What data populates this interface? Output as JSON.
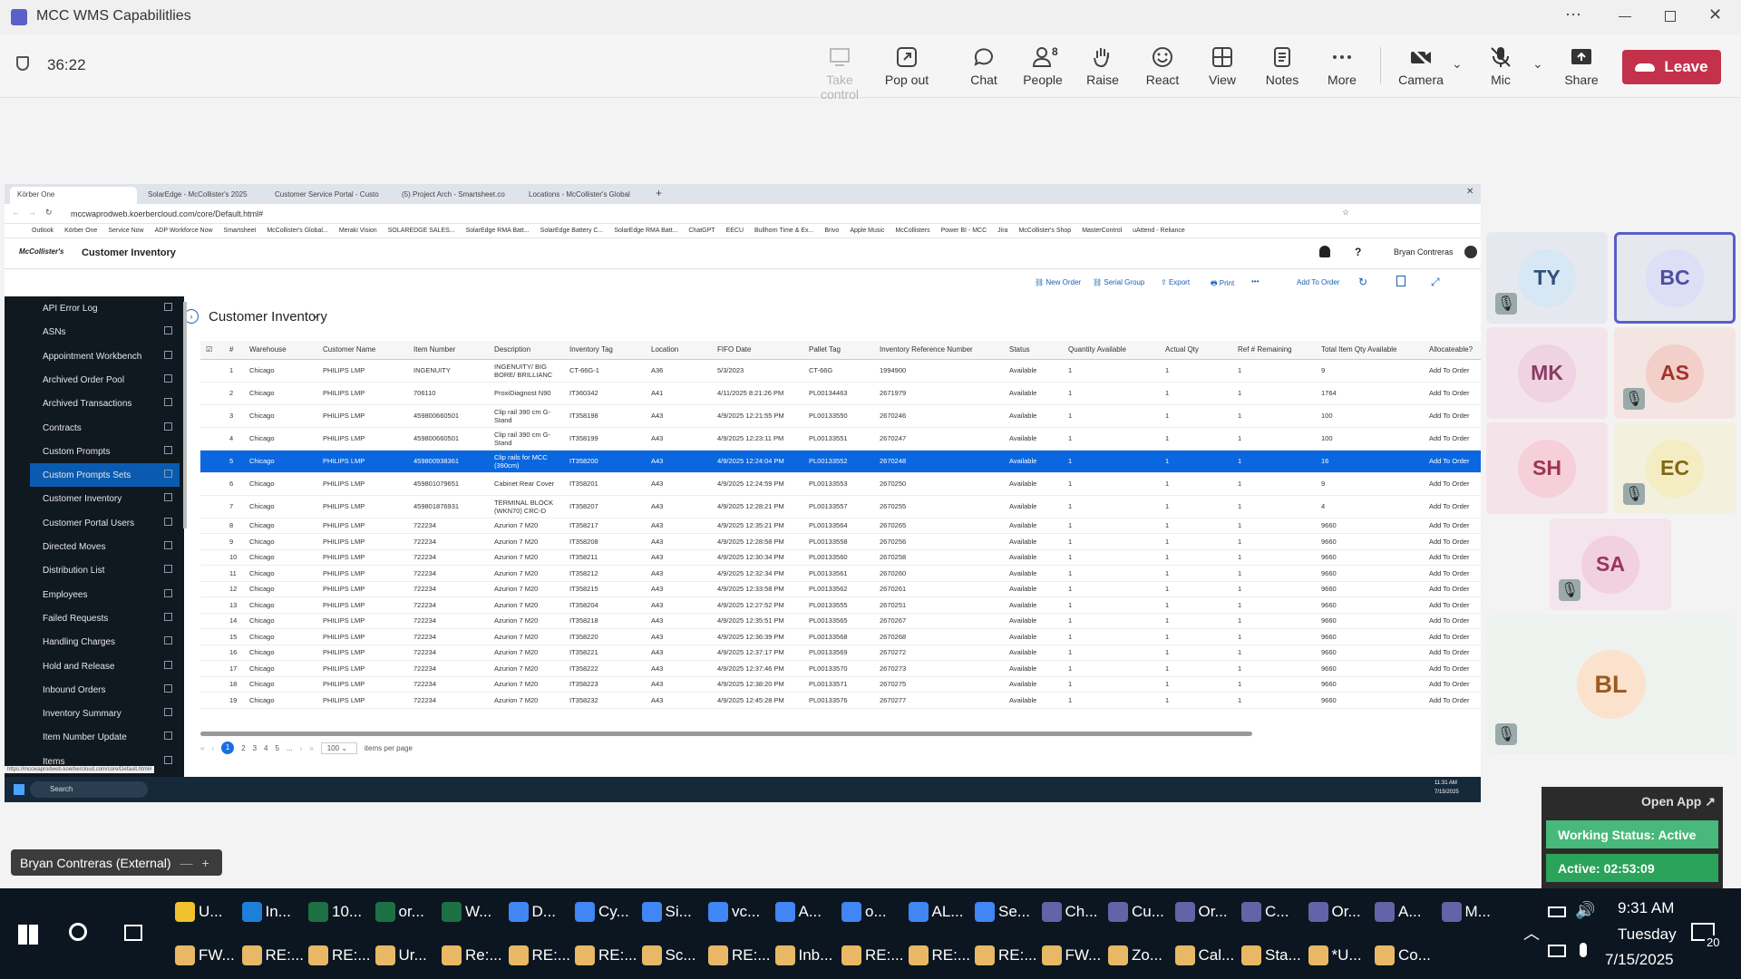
{
  "teams": {
    "window_title": "MCC WMS Capabilitlies",
    "timer": "36:22",
    "buttons": {
      "take_control": "Take control",
      "pop_out": "Pop out",
      "chat": "Chat",
      "people": "People",
      "people_count": "8",
      "raise": "Raise",
      "react": "React",
      "view": "View",
      "notes": "Notes",
      "more": "More",
      "camera": "Camera",
      "mic": "Mic",
      "share": "Share",
      "leave": "Leave"
    },
    "presenter_label": "Bryan Contreras (External)",
    "participants": [
      {
        "initials": "TY",
        "muted": true
      },
      {
        "initials": "BC",
        "muted": false
      },
      {
        "initials": "MK",
        "muted": false
      },
      {
        "initials": "AS",
        "muted": true
      },
      {
        "initials": "SH",
        "muted": false
      },
      {
        "initials": "EC",
        "muted": true
      },
      {
        "initials": "SA",
        "muted": true
      },
      {
        "initials": "BL",
        "muted": true
      }
    ],
    "open_app": "Open App",
    "working_status": "Working Status: Active",
    "active_timer": "Active: 02:53:09"
  },
  "browser": {
    "tabs": [
      "Körber One",
      "SolarEdge - McCollister's 2025",
      "Customer Service Portal - Custo",
      "(5) Project Arch - Smartsheet.co",
      "Locations - McCollister's Global"
    ],
    "url": "mccwaprodweb.koerbercloud.com/core/Default.html#",
    "bookmarks": [
      "Outlook",
      "Körber One",
      "Service Now",
      "ADP Workforce Now",
      "Smartsheet",
      "McCollister's Global...",
      "Meraki Vision",
      "SOLAREDGE SALES...",
      "SolarEdge RMA Batt...",
      "SolarEdge Battery C...",
      "SolarEdge RMA Batt...",
      "ChatGPT",
      "EECU",
      "Bullhorn Time & Ex...",
      "Brivo",
      "Apple Music",
      "McCollisters",
      "Power BI - MCC",
      "Jira",
      "McCollister's Shop",
      "MasterControl",
      "uAttend - Reliance"
    ],
    "status_url": "https://mccwaprodweb.koerbercloud.com/core/Default.html#"
  },
  "app": {
    "logo": "McCollister's",
    "module_title": "Customer Inventory",
    "user": "Bryan Contreras",
    "help": "?",
    "page_title": "Customer Inventory",
    "toolbar": {
      "new_order": "New Order",
      "serial_group": "Serial Group",
      "export": "Export",
      "print": "Print",
      "more": "•••",
      "add_to_order": "Add To Order"
    },
    "nav_items": [
      "API Error Log",
      "ASNs",
      "Appointment Workbench",
      "Archived Order Pool",
      "Archived Transactions",
      "Contracts",
      "Custom Prompts",
      "Custom Prompts Sets",
      "Customer Inventory",
      "Customer Portal Users",
      "Directed Moves",
      "Distribution List",
      "Employees",
      "Failed Requests",
      "Handling Charges",
      "Hold and Release",
      "Inbound Orders",
      "Inventory Summary",
      "Item Number Update",
      "Items"
    ],
    "selected_nav": "Custom Prompts Sets",
    "columns": [
      "#",
      "Warehouse",
      "Customer Name",
      "Item Number",
      "Description",
      "Inventory Tag",
      "Location",
      "FIFO Date",
      "Pallet Tag",
      "Inventory Reference Number",
      "Status",
      "Quantity Available",
      "Actual Qty",
      "Ref # Remaining",
      "Total Item Qty Available",
      "Allocateable?"
    ],
    "rows": [
      [
        "1",
        "Chicago",
        "PHILIPS LMP",
        "INGENUITY",
        "INGENUITY/ BIG BORE/ BRILLIANC",
        "CT-66G-1",
        "A36",
        "5/3/2023",
        "CT-66G",
        "1994900",
        "Available",
        "1",
        "1",
        "1",
        "9",
        "Add To Order"
      ],
      [
        "2",
        "Chicago",
        "PHILIPS LMP",
        "706110",
        "ProxiDiagnost N90",
        "IT360342",
        "A41",
        "4/11/2025 8:21:26 PM",
        "PL00134463",
        "2671979",
        "Available",
        "1",
        "1",
        "1",
        "1764",
        "Add To Order"
      ],
      [
        "3",
        "Chicago",
        "PHILIPS LMP",
        "459800660501",
        "Clip rail 390 cm G-Stand",
        "IT358198",
        "A43",
        "4/9/2025 12:21:55 PM",
        "PL00133550",
        "2670246",
        "Available",
        "1",
        "1",
        "1",
        "100",
        "Add To Order"
      ],
      [
        "4",
        "Chicago",
        "PHILIPS LMP",
        "459800660501",
        "Clip rail 390 cm G-Stand",
        "IT358199",
        "A43",
        "4/9/2025 12:23:11 PM",
        "PL00133551",
        "2670247",
        "Available",
        "1",
        "1",
        "1",
        "100",
        "Add To Order"
      ],
      [
        "5",
        "Chicago",
        "PHILIPS LMP",
        "459800938361",
        "Clip rails for MCC (390cm)",
        "IT358200",
        "A43",
        "4/9/2025 12:24:04 PM",
        "PL00133552",
        "2670248",
        "Available",
        "1",
        "1",
        "1",
        "16",
        "Add To Order"
      ],
      [
        "6",
        "Chicago",
        "PHILIPS LMP",
        "459801079651",
        "Cabinet Rear Cover",
        "IT358201",
        "A43",
        "4/9/2025 12:24:59 PM",
        "PL00133553",
        "2670250",
        "Available",
        "1",
        "1",
        "1",
        "9",
        "Add To Order"
      ],
      [
        "7",
        "Chicago",
        "PHILIPS LMP",
        "459801876931",
        "TERMINAL BLOCK (WKN70) CRC-D",
        "IT358207",
        "A43",
        "4/9/2025 12:28:21 PM",
        "PL00133557",
        "2670255",
        "Available",
        "1",
        "1",
        "1",
        "4",
        "Add To Order"
      ],
      [
        "8",
        "Chicago",
        "PHILIPS LMP",
        "722234",
        "Azurion 7 M20",
        "IT358217",
        "A43",
        "4/9/2025 12:35:21 PM",
        "PL00133564",
        "2670265",
        "Available",
        "1",
        "1",
        "1",
        "9660",
        "Add To Order"
      ],
      [
        "9",
        "Chicago",
        "PHILIPS LMP",
        "722234",
        "Azurion 7 M20",
        "IT358208",
        "A43",
        "4/9/2025 12:28:58 PM",
        "PL00133558",
        "2670256",
        "Available",
        "1",
        "1",
        "1",
        "9660",
        "Add To Order"
      ],
      [
        "10",
        "Chicago",
        "PHILIPS LMP",
        "722234",
        "Azurion 7 M20",
        "IT358211",
        "A43",
        "4/9/2025 12:30:34 PM",
        "PL00133560",
        "2670258",
        "Available",
        "1",
        "1",
        "1",
        "9660",
        "Add To Order"
      ],
      [
        "11",
        "Chicago",
        "PHILIPS LMP",
        "722234",
        "Azurion 7 M20",
        "IT358212",
        "A43",
        "4/9/2025 12:32:34 PM",
        "PL00133561",
        "2670260",
        "Available",
        "1",
        "1",
        "1",
        "9660",
        "Add To Order"
      ],
      [
        "12",
        "Chicago",
        "PHILIPS LMP",
        "722234",
        "Azurion 7 M20",
        "IT358215",
        "A43",
        "4/9/2025 12:33:58 PM",
        "PL00133562",
        "2670261",
        "Available",
        "1",
        "1",
        "1",
        "9660",
        "Add To Order"
      ],
      [
        "13",
        "Chicago",
        "PHILIPS LMP",
        "722234",
        "Azurion 7 M20",
        "IT358204",
        "A43",
        "4/9/2025 12:27:52 PM",
        "PL00133555",
        "2670251",
        "Available",
        "1",
        "1",
        "1",
        "9660",
        "Add To Order"
      ],
      [
        "14",
        "Chicago",
        "PHILIPS LMP",
        "722234",
        "Azurion 7 M20",
        "IT358218",
        "A43",
        "4/9/2025 12:35:51 PM",
        "PL00133565",
        "2670267",
        "Available",
        "1",
        "1",
        "1",
        "9660",
        "Add To Order"
      ],
      [
        "15",
        "Chicago",
        "PHILIPS LMP",
        "722234",
        "Azurion 7 M20",
        "IT358220",
        "A43",
        "4/9/2025 12:36:39 PM",
        "PL00133568",
        "2670268",
        "Available",
        "1",
        "1",
        "1",
        "9660",
        "Add To Order"
      ],
      [
        "16",
        "Chicago",
        "PHILIPS LMP",
        "722234",
        "Azurion 7 M20",
        "IT358221",
        "A43",
        "4/9/2025 12:37:17 PM",
        "PL00133569",
        "2670272",
        "Available",
        "1",
        "1",
        "1",
        "9660",
        "Add To Order"
      ],
      [
        "17",
        "Chicago",
        "PHILIPS LMP",
        "722234",
        "Azurion 7 M20",
        "IT358222",
        "A43",
        "4/9/2025 12:37:46 PM",
        "PL00133570",
        "2670273",
        "Available",
        "1",
        "1",
        "1",
        "9660",
        "Add To Order"
      ],
      [
        "18",
        "Chicago",
        "PHILIPS LMP",
        "722234",
        "Azurion 7 M20",
        "IT358223",
        "A43",
        "4/9/2025 12:38:20 PM",
        "PL00133571",
        "2670275",
        "Available",
        "1",
        "1",
        "1",
        "9660",
        "Add To Order"
      ],
      [
        "19",
        "Chicago",
        "PHILIPS LMP",
        "722234",
        "Azurion 7 M20",
        "IT358232",
        "A43",
        "4/9/2025 12:45:28 PM",
        "PL00133576",
        "2670277",
        "Available",
        "1",
        "1",
        "1",
        "9660",
        "Add To Order"
      ]
    ],
    "selected_row": 4,
    "pager": {
      "pages": [
        "1",
        "2",
        "3",
        "4",
        "5",
        "..."
      ],
      "page_size": "100",
      "items_per_page": "items per page"
    },
    "inner_search": "Search",
    "inner_time": "11:31 AM",
    "inner_date": "7/15/2025"
  },
  "taskbar": {
    "row1": [
      "U...",
      "In...",
      "10...",
      "or...",
      "W...",
      "D...",
      "Cy...",
      "Si...",
      "vc...",
      "A...",
      "o...",
      "AL...",
      "Se...",
      "Ch...",
      "Cu...",
      "Or...",
      "C...",
      "Or...",
      "A...",
      "M..."
    ],
    "row2": [
      "FW...",
      "RE:...",
      "RE:...",
      "Ur...",
      "Re:...",
      "RE:...",
      "RE:...",
      "Sc...",
      "RE:...",
      "Inb...",
      "RE:...",
      "RE:...",
      "RE:...",
      "FW...",
      "Zo...",
      "Cal...",
      "Sta...",
      "*U...",
      "Co..."
    ],
    "time": "9:31 AM",
    "day": "Tuesday",
    "date": "7/15/2025",
    "notifications": "20"
  },
  "colors": {
    "accent": "#0a67e0",
    "leave": "#c4314b",
    "status_green": "#2ca35a"
  }
}
